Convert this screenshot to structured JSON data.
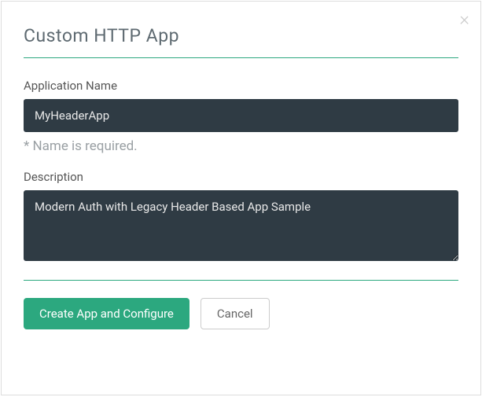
{
  "modal": {
    "title": "Custom HTTP App",
    "close_label": "×"
  },
  "form": {
    "app_name": {
      "label": "Application Name",
      "value": "MyHeaderApp",
      "help": "* Name is required."
    },
    "description": {
      "label": "Description",
      "value": "Modern Auth with Legacy Header Based App Sample"
    }
  },
  "buttons": {
    "submit": "Create App and Configure",
    "cancel": "Cancel"
  }
}
